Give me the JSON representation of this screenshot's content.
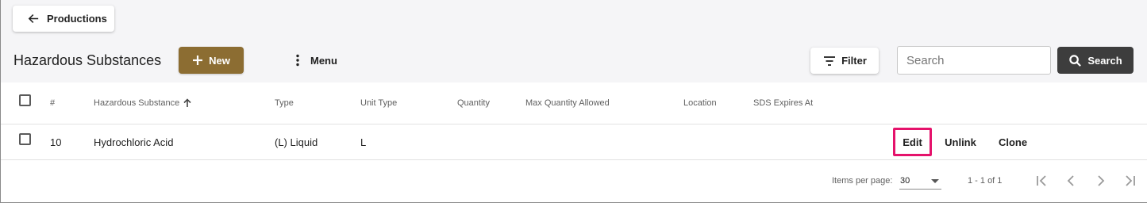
{
  "header": {
    "back_label": "Productions",
    "title": "Hazardous Substances",
    "new_label": "New",
    "menu_label": "Menu",
    "filter_label": "Filter",
    "search_placeholder": "Search",
    "search_value": "",
    "search_button_label": "Search"
  },
  "table": {
    "columns": {
      "number": "#",
      "substance": "Hazardous Substance",
      "type": "Type",
      "unit_type": "Unit Type",
      "quantity": "Quantity",
      "max_quantity": "Max Quantity Allowed",
      "location": "Location",
      "sds_expires": "SDS Expires At"
    },
    "sort": {
      "column": "Hazardous Substance",
      "direction": "ascending"
    },
    "rows": [
      {
        "number": "10",
        "substance": "Hydrochloric Acid",
        "type": "(L) Liquid",
        "unit_type": "L",
        "quantity": "",
        "max_quantity": "",
        "location": "",
        "sds_expires": "",
        "actions": {
          "edit": "Edit",
          "unlink": "Unlink",
          "clone": "Clone"
        }
      }
    ]
  },
  "paginator": {
    "items_per_page_label": "Items per page:",
    "page_size": "30",
    "range_label": "1 - 1 of 1"
  },
  "colors": {
    "new_button": "#8c6d32",
    "search_button": "#3d3d3d",
    "highlight": "#e5126b",
    "page_background": "#f5f5f7"
  },
  "icons": {
    "back": "arrow-left-icon",
    "new": "plus-icon",
    "menu": "more-vertical-icon",
    "filter": "filter-lines-icon",
    "search": "magnifier-icon",
    "sort": "arrow-up-icon",
    "first_page": "first-page-icon",
    "prev_page": "chevron-left-icon",
    "next_page": "chevron-right-icon",
    "last_page": "last-page-icon"
  }
}
